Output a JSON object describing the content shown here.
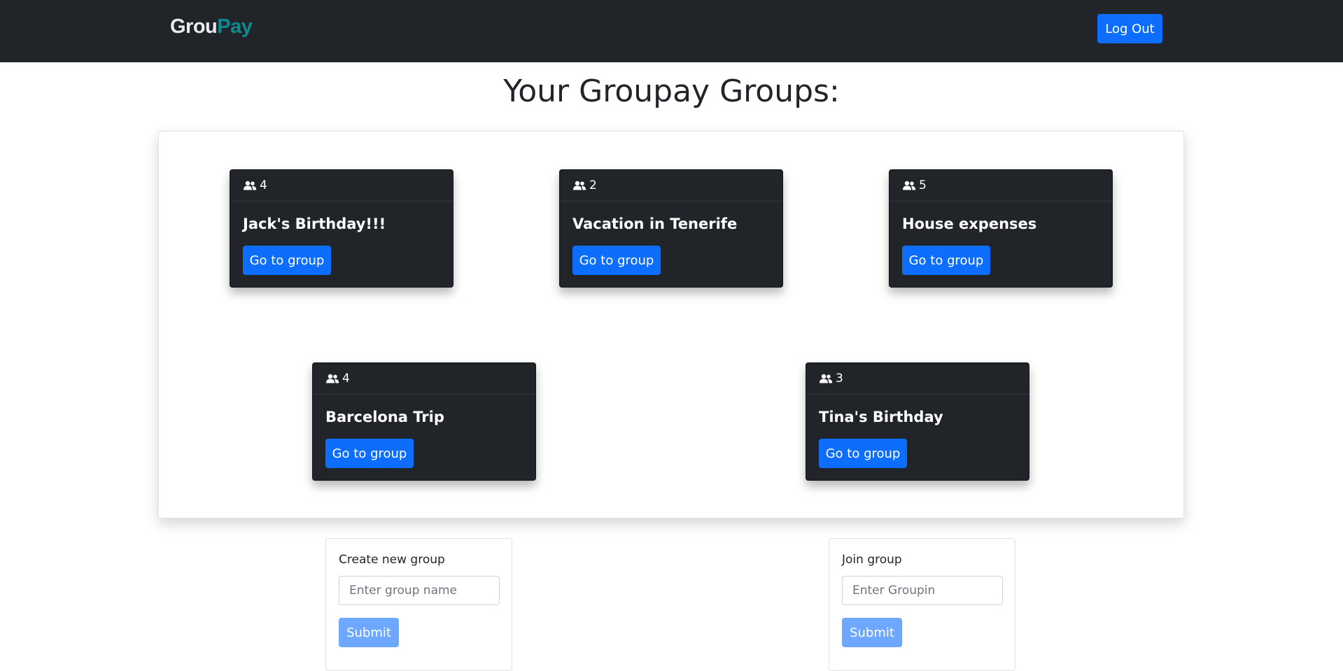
{
  "navbar": {
    "brand_part1": "Grou",
    "brand_part2": "Pay",
    "logout_label": "Log Out"
  },
  "page_title": "Your Groupay Groups:",
  "groups": [
    {
      "members": "4",
      "name": "Jack's Birthday!!!",
      "button_label": "Go to group"
    },
    {
      "members": "2",
      "name": "Vacation in Tenerife",
      "button_label": "Go to group"
    },
    {
      "members": "5",
      "name": "House expenses",
      "button_label": "Go to group"
    },
    {
      "members": "4",
      "name": "Barcelona Trip",
      "button_label": "Go to group"
    },
    {
      "members": "3",
      "name": "Tina's Birthday",
      "button_label": "Go to group"
    }
  ],
  "create_group": {
    "label": "Create new group",
    "placeholder": "Enter group name",
    "submit_label": "Submit"
  },
  "join_group": {
    "label": "Join group",
    "placeholder": "Enter Groupin",
    "submit_label": "Submit"
  },
  "colors": {
    "navbar_bg": "#212529",
    "brand_accent": "#0e8a8f",
    "primary": "#0d6efd",
    "primary_disabled": "#6ea8fe"
  },
  "icons": {
    "members": "people-icon"
  }
}
